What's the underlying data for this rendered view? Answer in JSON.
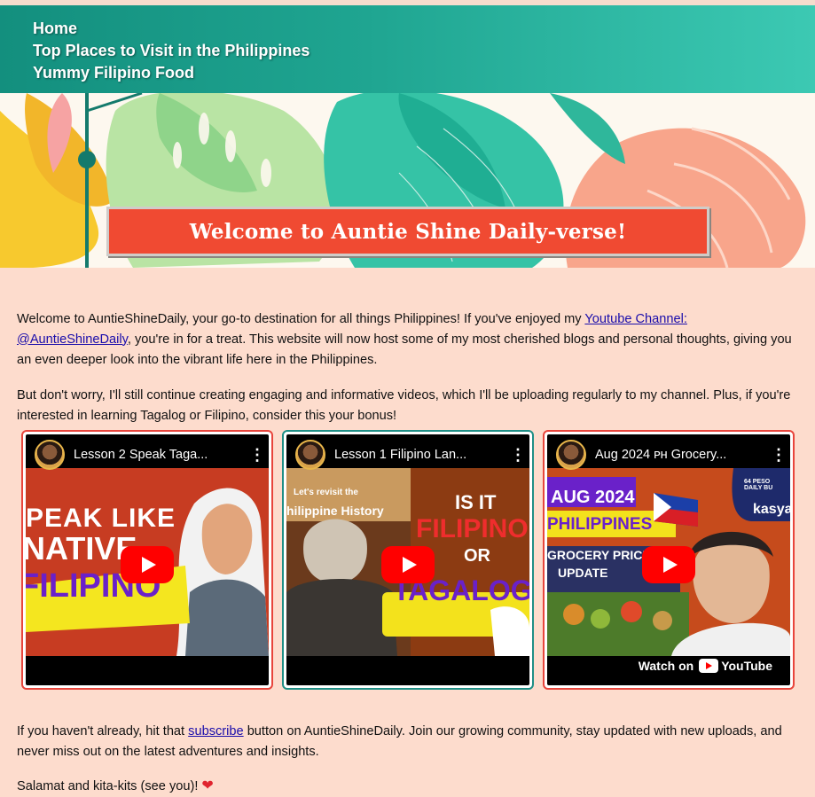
{
  "nav": {
    "items": [
      {
        "label": "Home"
      },
      {
        "label": "Top Places to Visit in the Philippines"
      },
      {
        "label": "Yummy Filipino Food"
      }
    ]
  },
  "banner": {
    "title": "Welcome to Auntie Shine Daily-verse!"
  },
  "intro": {
    "text_before_link": "Welcome to AuntieShineDaily, your go-to destination for all things Philippines! If you've enjoyed my ",
    "link_text": "Youtube Channel: @AuntieShineDaily",
    "text_after_link": ", you're in for a treat. This website will now host some of my most cherished blogs and personal thoughts, giving you an even deeper look into the vibrant life here in the Philippines."
  },
  "paragraph2": "But don't worry, I'll still continue creating engaging and informative videos, which I'll be uploading regularly to my channel. Plus, if you're interested in learning Tagalog or Filipino, consider this your bonus!",
  "videos": [
    {
      "title": "Lesson 2 Speak Taga...",
      "thumb_line1": "PEAK LIKE",
      "thumb_line2": "NATIVE",
      "thumb_line3": "FILIPINO",
      "border": "#e8453c"
    },
    {
      "title": "Lesson 1 Filipino Lan...",
      "thumb_line1": "Let's revisit the",
      "thumb_line2": "hilippine History",
      "thumb_line3": "IS IT",
      "thumb_line4": "FILIPINO",
      "thumb_line5": "OR",
      "thumb_line6": "TAGALOG",
      "border": "#1f8f86"
    },
    {
      "title": "Aug 2024 ᴘʜ Grocery...",
      "thumb_line1": "AUG 2024",
      "thumb_line2": "PHILIPPINES",
      "thumb_line3": "GROCERY PRICE",
      "thumb_line4": "UPDATE",
      "thumb_line5": "64 PESO DAILY BU",
      "thumb_line6": "kasya",
      "watch_label": "Watch on",
      "watch_brand": "YouTube",
      "border": "#e8453c"
    }
  ],
  "outro": {
    "text_before_link": "If you haven't already, hit that ",
    "link_text": "subscribe",
    "text_after_link": " button on AuntieShineDaily. Join our growing community, stay updated with new uploads, and never miss out on the latest adventures and insights."
  },
  "closing": "Salamat and kita-kits (see you)!",
  "colors": {
    "nav_start": "#138f7e",
    "nav_end": "#3cc9b3",
    "page_bg": "#fddccd",
    "banner_box": "#f04a32",
    "link": "#1a0dab",
    "youtube_red": "#ff0000"
  }
}
